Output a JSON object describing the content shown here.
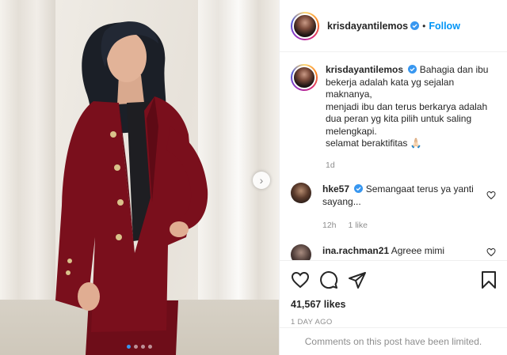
{
  "post": {
    "username": "krisdayantilemos",
    "follow_label": "Follow",
    "separator": "•",
    "caption": {
      "username": "krisdayantilemos",
      "lines": [
        "Bahagia dan ibu bekerja adalah kata yg sejalan maknanya,",
        "menjadi ibu dan terus berkarya adalah dua peran yg kita pilih untuk saling melengkapi.",
        "selamat beraktifitas 🙏🏻"
      ],
      "time": "1d"
    },
    "comments": [
      {
        "username": "hke57",
        "text": "Semangaat terus ya yanti sayang...",
        "time": "12h",
        "likes": "1 like"
      },
      {
        "username": "ina.rachman21",
        "text": "Agreee mimi"
      }
    ],
    "likes": "41,567 likes",
    "posted": "1 DAY AGO",
    "comments_limited": "Comments on this post have been limited."
  },
  "carousel": {
    "slide_count": 4,
    "active_index": 0
  },
  "colors": {
    "follow": "#0095f6",
    "verified": "#3897f0",
    "muted": "#8e8e8e",
    "jacket": "#7a0f1c"
  },
  "icons": [
    "verified-icon",
    "heart-icon",
    "comment-icon",
    "share-icon",
    "bookmark-icon",
    "chevron-right-icon"
  ]
}
